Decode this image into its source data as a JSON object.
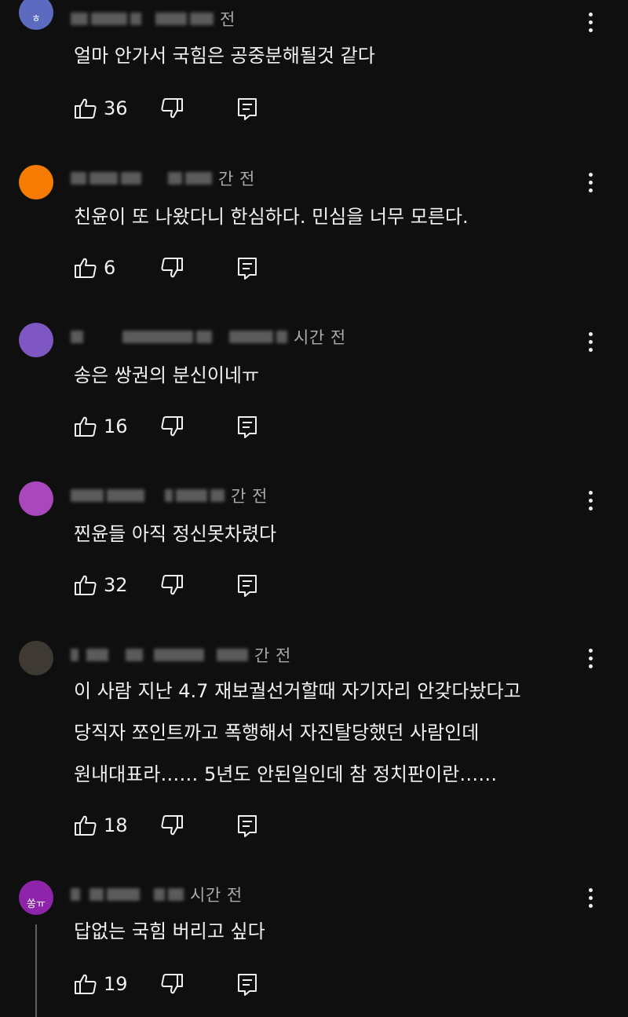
{
  "comments": [
    {
      "time": "전",
      "text": [
        "얼마 안가서 국힘은 공중분해될것 같다"
      ],
      "likes": "36",
      "avatar": {
        "color": "#5c6bc0",
        "glyph": "ㅎ"
      }
    },
    {
      "time": "간 전",
      "text": [
        "친윤이 또 나왔다니 한심하다. 민심을 너무 모른다."
      ],
      "likes": "6",
      "avatar": {
        "color": "#f57c00",
        "glyph": ""
      }
    },
    {
      "time": "시간 전",
      "text": [
        "송은 쌍권의 분신이네ㅠ"
      ],
      "likes": "16",
      "avatar": {
        "color": "#7e57c2",
        "glyph": ""
      }
    },
    {
      "time": "간 전",
      "text": [
        "찐윤들 아직 정신못차렸다"
      ],
      "likes": "32",
      "avatar": {
        "color": "#ab47bc",
        "glyph": ""
      }
    },
    {
      "time": "간 전",
      "text": [
        "이 사람 지난 4.7 재보궐선거할때 자기자리 안갖다놨다고",
        "당직자 쪼인트까고 폭행해서 자진탈당했던 사람인데",
        "원내대표라…… 5년도 안된일인데 참 정치판이란……"
      ],
      "likes": "18",
      "avatar": {
        "color": "#3e3a33",
        "glyph": ""
      }
    },
    {
      "time": "시간 전",
      "text": [
        "답없는 국힘 버리고 싶다"
      ],
      "likes": "19",
      "avatar": {
        "color": "#8e24aa",
        "glyph": "쏭ㅠ"
      }
    }
  ],
  "icons": {
    "like": "thumb-up-icon",
    "dislike": "thumb-down-icon",
    "reply": "reply-comment-icon",
    "more": "more-vert-icon"
  },
  "colors": {
    "background": "#0f0f0f",
    "text": "#f1f1f1",
    "secondary": "#aaaaaa"
  }
}
